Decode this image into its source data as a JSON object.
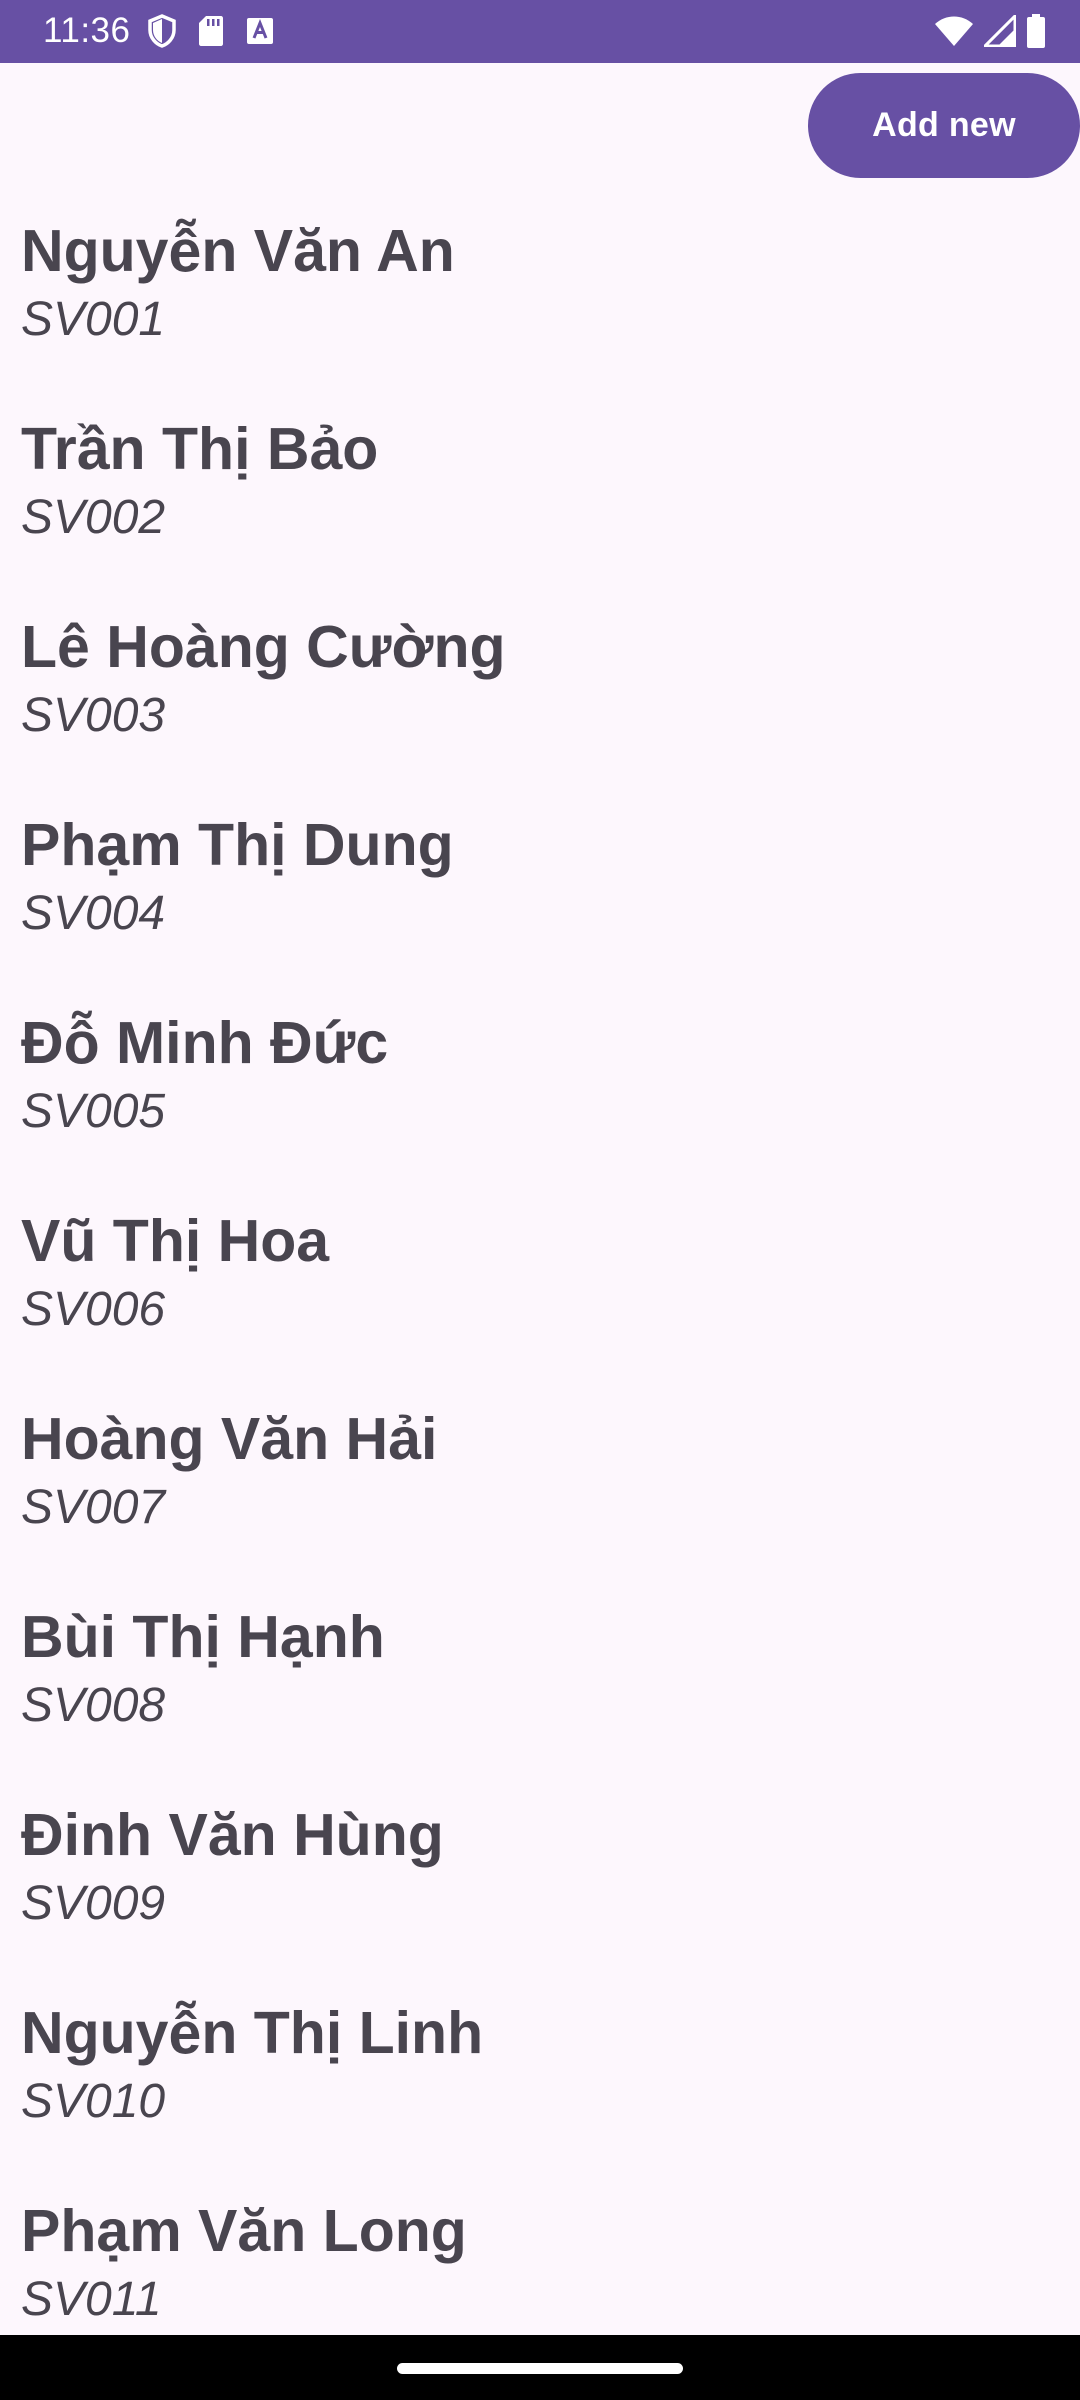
{
  "status_bar": {
    "time": "11:36",
    "left_icons": [
      "shield-icon",
      "sd-card-icon",
      "keyboard-a-icon"
    ],
    "right_icons": [
      "wifi-icon",
      "cell-signal-icon",
      "battery-icon"
    ],
    "background_color": "#6750a4"
  },
  "toolbar": {
    "add_label": "Add new"
  },
  "students": [
    {
      "name": "Nguyễn Văn An",
      "id": "SV001"
    },
    {
      "name": "Trần Thị Bảo",
      "id": "SV002"
    },
    {
      "name": "Lê Hoàng Cường",
      "id": "SV003"
    },
    {
      "name": "Phạm Thị Dung",
      "id": "SV004"
    },
    {
      "name": "Đỗ Minh Đức",
      "id": "SV005"
    },
    {
      "name": "Vũ Thị Hoa",
      "id": "SV006"
    },
    {
      "name": "Hoàng Văn Hải",
      "id": "SV007"
    },
    {
      "name": "Bùi Thị Hạnh",
      "id": "SV008"
    },
    {
      "name": "Đinh Văn Hùng",
      "id": "SV009"
    },
    {
      "name": "Nguyễn Thị Linh",
      "id": "SV010"
    },
    {
      "name": "Phạm Văn Long",
      "id": "SV011"
    }
  ],
  "colors": {
    "accent": "#6750a4",
    "background": "#fdf7fd",
    "text": "#49454f"
  }
}
